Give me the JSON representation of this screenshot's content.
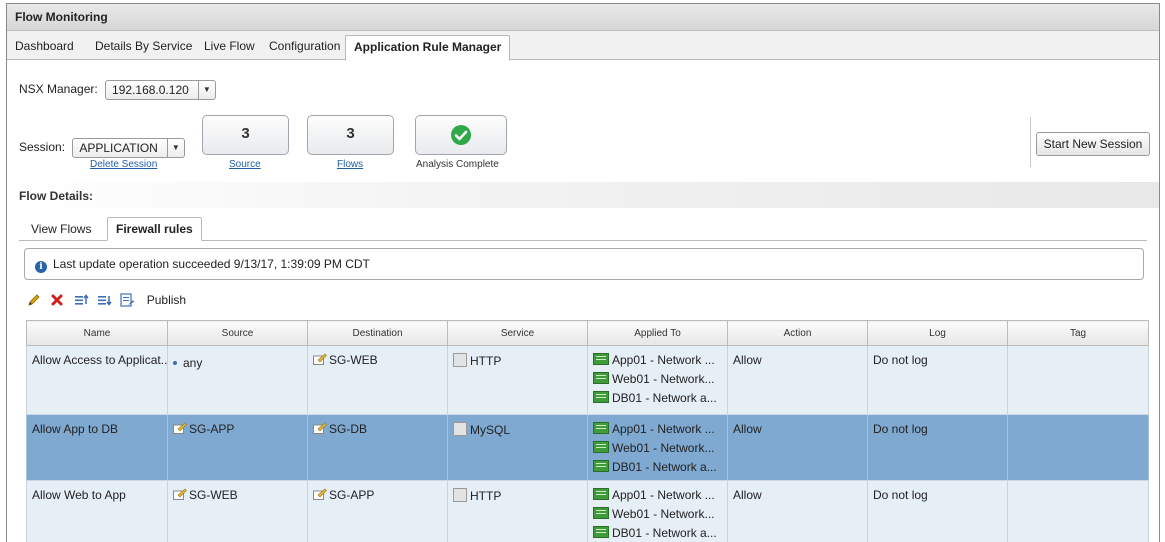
{
  "window": {
    "title": "Flow Monitoring"
  },
  "tabs": [
    {
      "label": "Dashboard"
    },
    {
      "label": "Details By Service"
    },
    {
      "label": "Live Flow"
    },
    {
      "label": "Configuration"
    },
    {
      "label": "Application Rule Manager",
      "active": true
    }
  ],
  "nsx": {
    "label": "NSX Manager:",
    "value": "192.168.0.120"
  },
  "session": {
    "label": "Session:",
    "value": "APPLICATION",
    "delete_link": "Delete Session",
    "source_count": "3",
    "source_label": "Source",
    "flows_count": "3",
    "flows_label": "Flows",
    "status_label": "Analysis Complete",
    "start_button": "Start New Session"
  },
  "flow_details": {
    "label": "Flow Details:"
  },
  "subtabs": [
    {
      "label": "View Flows"
    },
    {
      "label": "Firewall rules",
      "active": true
    }
  ],
  "info": {
    "message": "Last update operation succeeded 9/13/17, 1:39:09 PM CDT"
  },
  "toolbar": {
    "publish_label": "Publish"
  },
  "table": {
    "columns": [
      "Name",
      "Source",
      "Destination",
      "Service",
      "Applied To",
      "Action",
      "Log",
      "Tag"
    ],
    "rows": [
      {
        "name": "Allow Access to Applicat...",
        "source": "any",
        "destination": "SG-WEB",
        "service": "HTTP",
        "applied": [
          "App01 - Network ...",
          "Web01 - Network...",
          "DB01 - Network a..."
        ],
        "action": "Allow",
        "log": "Do not log",
        "tag": ""
      },
      {
        "name": "Allow App to DB",
        "source": "SG-APP",
        "destination": "SG-DB",
        "service": "MySQL",
        "applied": [
          "App01 - Network ...",
          "Web01 - Network...",
          "DB01 - Network a..."
        ],
        "action": "Allow",
        "log": "Do not log",
        "tag": ""
      },
      {
        "name": "Allow Web to App",
        "source": "SG-WEB",
        "destination": "SG-APP",
        "service": "HTTP",
        "applied": [
          "App01 - Network ...",
          "Web01 - Network...",
          "DB01 - Network a..."
        ],
        "action": "Allow",
        "log": "Do not log",
        "tag": ""
      }
    ]
  },
  "colors": {
    "accent": "#1f5fa6",
    "selected_row": "#7fa9d1",
    "row_bg": "#e6eef6",
    "success": "#2fa84a"
  }
}
